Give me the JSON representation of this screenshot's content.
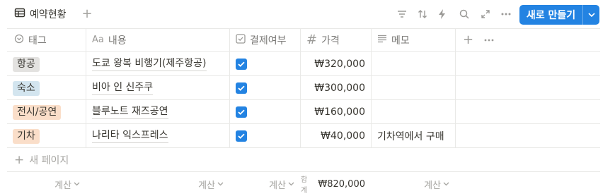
{
  "toolbar": {
    "view_name": "예약현황",
    "new_button_label": "새로 만들기",
    "icons": [
      "filter-icon",
      "sort-icon",
      "lightning-icon",
      "search-icon",
      "expand-icon",
      "more-icon"
    ]
  },
  "columns": [
    {
      "label": "태그",
      "icon": "select-icon"
    },
    {
      "label": "내용",
      "icon": "text-title-icon"
    },
    {
      "label": "결제여부",
      "icon": "checkbox-icon"
    },
    {
      "label": "가격",
      "icon": "number-icon"
    },
    {
      "label": "메모",
      "icon": "text-icon"
    }
  ],
  "column_header_icon_text": {
    "title": "Aa",
    "number": "#"
  },
  "rows": [
    {
      "tag": "항공",
      "tag_color": "#e3e2e0",
      "name": "도쿄 왕복 비행기(제주항공)",
      "paid": true,
      "price": "₩320,000",
      "memo": ""
    },
    {
      "tag": "숙소",
      "tag_color": "#d3e5ef",
      "name": "비아 인 신주쿠",
      "paid": true,
      "price": "₩300,000",
      "memo": ""
    },
    {
      "tag": "전시/공연",
      "tag_color": "#fadec9",
      "name": "블루노트 재즈공연",
      "paid": true,
      "price": "₩160,000",
      "memo": ""
    },
    {
      "tag": "기차",
      "tag_color": "#fadec9",
      "name": "나리타 익스프레스",
      "paid": true,
      "price": "₩40,000",
      "memo": "기차역에서 구매"
    }
  ],
  "new_page_label": "새 페이지",
  "footer": {
    "calc_label": "계산",
    "sum_label": "합계",
    "sum_value": "₩820,000"
  },
  "colors": {
    "accent": "#2383e2",
    "border": "#e9e9e7",
    "muted": "#9b9a97"
  }
}
